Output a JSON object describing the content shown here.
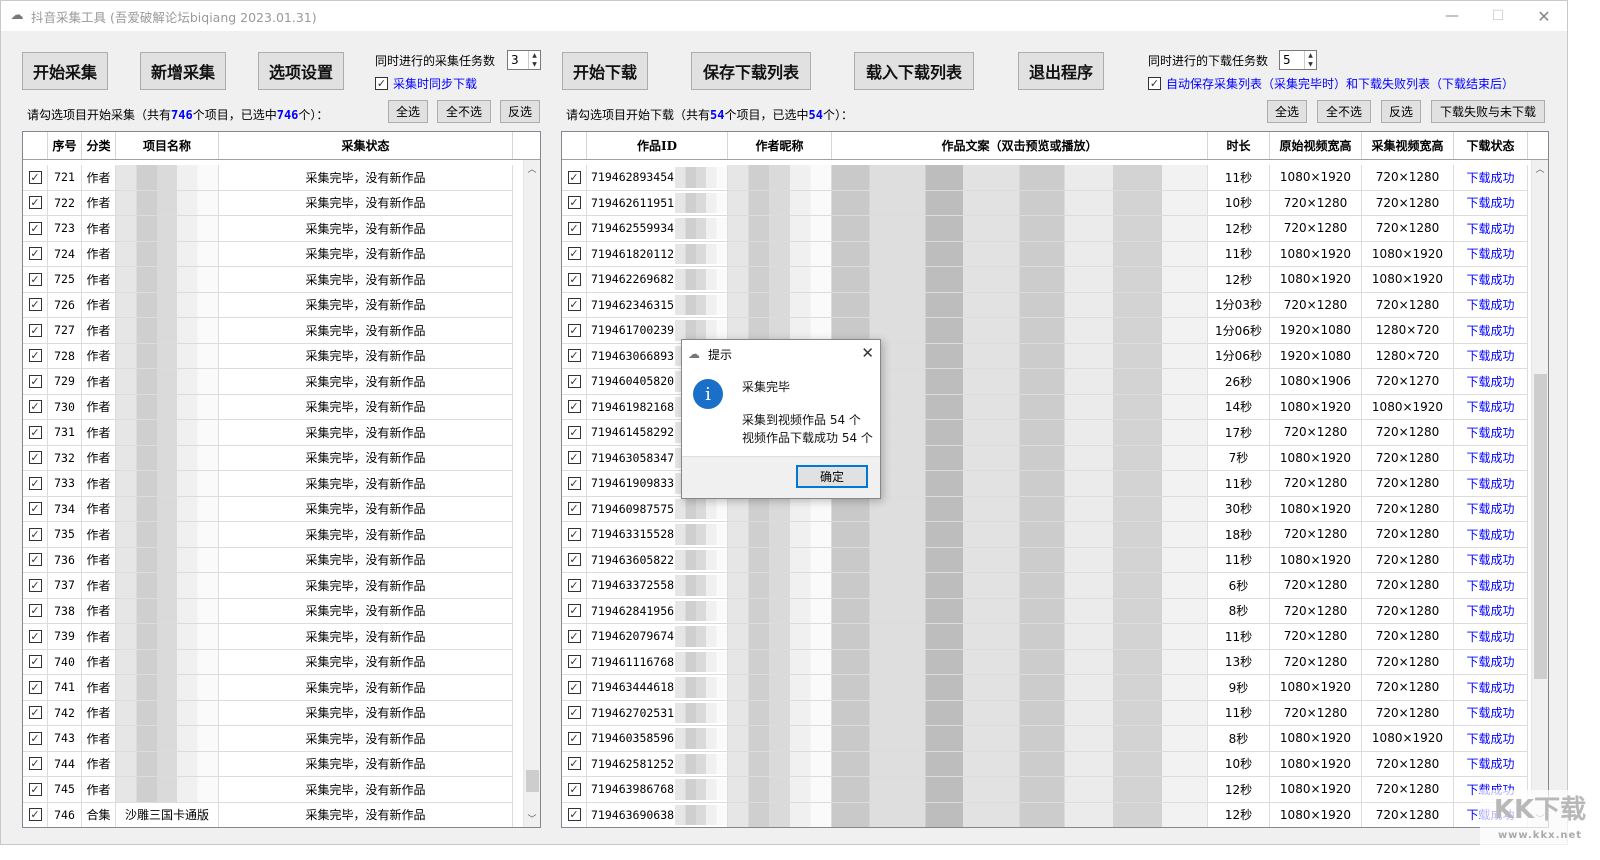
{
  "window": {
    "title": "抖音采集工具 (吾爱破解论坛biqiang 2023.01.31)",
    "controls": {
      "minimize": "—",
      "maximize": "☐",
      "close": "✕"
    }
  },
  "toolbar_left": {
    "buttons": [
      "开始采集",
      "新增采集",
      "选项设置"
    ],
    "concurrent_label": "同时进行的采集任务数",
    "concurrent_value": "3",
    "sync_download_label": "采集时同步下载",
    "sync_download_checked": true
  },
  "toolbar_right": {
    "buttons": [
      "开始下载",
      "保存下载列表",
      "载入下载列表",
      "退出程序"
    ],
    "concurrent_label": "同时进行的下载任务数",
    "concurrent_value": "5",
    "autosave_label": "自动保存采集列表（采集完毕时）和下载失败列表（下载结束后）",
    "autosave_checked": true
  },
  "collect_panel": {
    "summary_prefix": "请勾选项目开始采集（共有",
    "total": "746",
    "summary_mid": "个项目，已选中",
    "selected": "746",
    "summary_suffix": "个）：",
    "select_buttons": [
      "全选",
      "全不选",
      "反选"
    ],
    "columns": [
      "",
      "序号",
      "分类",
      "项目名称",
      "采集状态"
    ],
    "rows": [
      {
        "no": "721",
        "type": "作者",
        "name": "",
        "status": "采集完毕，没有新作品"
      },
      {
        "no": "722",
        "type": "作者",
        "name": "",
        "status": "采集完毕，没有新作品"
      },
      {
        "no": "723",
        "type": "作者",
        "name": "",
        "status": "采集完毕，没有新作品"
      },
      {
        "no": "724",
        "type": "作者",
        "name": "",
        "status": "采集完毕，没有新作品"
      },
      {
        "no": "725",
        "type": "作者",
        "name": "",
        "status": "采集完毕，没有新作品"
      },
      {
        "no": "726",
        "type": "作者",
        "name": "",
        "status": "采集完毕，没有新作品"
      },
      {
        "no": "727",
        "type": "作者",
        "name": "",
        "status": "采集完毕，没有新作品"
      },
      {
        "no": "728",
        "type": "作者",
        "name": "",
        "status": "采集完毕，没有新作品"
      },
      {
        "no": "729",
        "type": "作者",
        "name": "",
        "status": "采集完毕，没有新作品"
      },
      {
        "no": "730",
        "type": "作者",
        "name": "",
        "status": "采集完毕，没有新作品"
      },
      {
        "no": "731",
        "type": "作者",
        "name": "",
        "status": "采集完毕，没有新作品"
      },
      {
        "no": "732",
        "type": "作者",
        "name": "",
        "status": "采集完毕，没有新作品"
      },
      {
        "no": "733",
        "type": "作者",
        "name": "",
        "status": "采集完毕，没有新作品"
      },
      {
        "no": "734",
        "type": "作者",
        "name": "",
        "status": "采集完毕，没有新作品"
      },
      {
        "no": "735",
        "type": "作者",
        "name": "",
        "status": "采集完毕，没有新作品"
      },
      {
        "no": "736",
        "type": "作者",
        "name": "",
        "status": "采集完毕，没有新作品"
      },
      {
        "no": "737",
        "type": "作者",
        "name": "",
        "status": "采集完毕，没有新作品"
      },
      {
        "no": "738",
        "type": "作者",
        "name": "",
        "status": "采集完毕，没有新作品"
      },
      {
        "no": "739",
        "type": "作者",
        "name": "",
        "status": "采集完毕，没有新作品"
      },
      {
        "no": "740",
        "type": "作者",
        "name": "",
        "status": "采集完毕，没有新作品"
      },
      {
        "no": "741",
        "type": "作者",
        "name": "",
        "status": "采集完毕，没有新作品"
      },
      {
        "no": "742",
        "type": "作者",
        "name": "",
        "status": "采集完毕，没有新作品"
      },
      {
        "no": "743",
        "type": "作者",
        "name": "",
        "status": "采集完毕，没有新作品"
      },
      {
        "no": "744",
        "type": "作者",
        "name": "",
        "status": "采集完毕，没有新作品"
      },
      {
        "no": "745",
        "type": "作者",
        "name": "",
        "status": "采集完毕，没有新作品"
      },
      {
        "no": "746",
        "type": "合集",
        "name": "沙雕三国卡通版",
        "status": "采集完毕，没有新作品"
      }
    ],
    "scroll_position": 0.97
  },
  "download_panel": {
    "summary_prefix": "请勾选项目开始下载（共有",
    "total": "54",
    "summary_mid": "个项目，已选中",
    "selected": "54",
    "summary_suffix": "个）：",
    "select_buttons": [
      "全选",
      "全不选",
      "反选",
      "下载失败与未下载"
    ],
    "columns": [
      "",
      "作品ID",
      "作者昵称",
      "作品文案（双击预览或播放）",
      "时长",
      "原始视频宽高",
      "采集视频宽高",
      "下载状态"
    ],
    "rows": [
      {
        "id": "719462893454",
        "dur": "11秒",
        "orig": "1080×1920",
        "coll": "720×1280",
        "status": "下载成功"
      },
      {
        "id": "719462611951",
        "dur": "10秒",
        "orig": "720×1280",
        "coll": "720×1280",
        "status": "下载成功"
      },
      {
        "id": "719462559934",
        "dur": "12秒",
        "orig": "720×1280",
        "coll": "720×1280",
        "status": "下载成功"
      },
      {
        "id": "719461820112",
        "dur": "11秒",
        "orig": "1080×1920",
        "coll": "1080×1920",
        "status": "下载成功"
      },
      {
        "id": "719462269682",
        "dur": "12秒",
        "orig": "1080×1920",
        "coll": "1080×1920",
        "status": "下载成功"
      },
      {
        "id": "719462346315",
        "dur": "1分03秒",
        "orig": "720×1280",
        "coll": "720×1280",
        "status": "下载成功"
      },
      {
        "id": "719461700239",
        "dur": "1分06秒",
        "orig": "1920×1080",
        "coll": "1280×720",
        "status": "下载成功"
      },
      {
        "id": "719463066893",
        "dur": "1分06秒",
        "orig": "1920×1080",
        "coll": "1280×720",
        "status": "下载成功"
      },
      {
        "id": "719460405820",
        "dur": "26秒",
        "orig": "1080×1906",
        "coll": "720×1270",
        "status": "下载成功"
      },
      {
        "id": "719461982168",
        "dur": "14秒",
        "orig": "1080×1920",
        "coll": "1080×1920",
        "status": "下载成功"
      },
      {
        "id": "719461458292",
        "dur": "17秒",
        "orig": "720×1280",
        "coll": "720×1280",
        "status": "下载成功"
      },
      {
        "id": "719463058347",
        "dur": "7秒",
        "orig": "1080×1920",
        "coll": "720×1280",
        "status": "下载成功"
      },
      {
        "id": "719461909833",
        "dur": "11秒",
        "orig": "720×1280",
        "coll": "720×1280",
        "status": "下载成功"
      },
      {
        "id": "719460987575",
        "dur": "30秒",
        "orig": "1080×1920",
        "coll": "720×1280",
        "status": "下载成功"
      },
      {
        "id": "719463315528",
        "dur": "18秒",
        "orig": "720×1280",
        "coll": "720×1280",
        "status": "下载成功"
      },
      {
        "id": "719463605822",
        "dur": "11秒",
        "orig": "1080×1920",
        "coll": "720×1280",
        "status": "下载成功"
      },
      {
        "id": "719463372558",
        "dur": "6秒",
        "orig": "720×1280",
        "coll": "720×1280",
        "status": "下载成功"
      },
      {
        "id": "719462841956",
        "dur": "8秒",
        "orig": "720×1280",
        "coll": "720×1280",
        "status": "下载成功"
      },
      {
        "id": "719462079674",
        "dur": "11秒",
        "orig": "720×1280",
        "coll": "720×1280",
        "status": "下载成功"
      },
      {
        "id": "719461116768",
        "dur": "13秒",
        "orig": "720×1280",
        "coll": "720×1280",
        "status": "下载成功"
      },
      {
        "id": "719463444618",
        "dur": "9秒",
        "orig": "1080×1920",
        "coll": "720×1280",
        "status": "下载成功"
      },
      {
        "id": "719462702531",
        "dur": "11秒",
        "orig": "720×1280",
        "coll": "720×1280",
        "status": "下载成功"
      },
      {
        "id": "719460358596",
        "dur": "8秒",
        "orig": "1080×1920",
        "coll": "1080×1920",
        "status": "下载成功"
      },
      {
        "id": "719462581252",
        "dur": "10秒",
        "orig": "1080×1920",
        "coll": "720×1280",
        "status": "下载成功"
      },
      {
        "id": "719463986768",
        "dur": "12秒",
        "orig": "1080×1920",
        "coll": "720×1280",
        "status": "下载成功"
      },
      {
        "id": "719463690638",
        "dur": "12秒",
        "orig": "1080×1920",
        "coll": "720×1280",
        "status": "下载成功"
      }
    ],
    "scroll_position": 0.6
  },
  "dialog": {
    "title": "提示",
    "line1": "采集完毕",
    "line2": "采集到视频作品 54 个",
    "line3": "视频作品下载成功 54 个",
    "ok_label": "确定",
    "icon": "info-icon"
  },
  "watermark": {
    "text": "KK下载",
    "url": "www.kkx.net"
  },
  "colors": {
    "accent_blue": "#0000ff",
    "info_blue": "#1a6fc9",
    "focus_border": "#0078d7"
  }
}
